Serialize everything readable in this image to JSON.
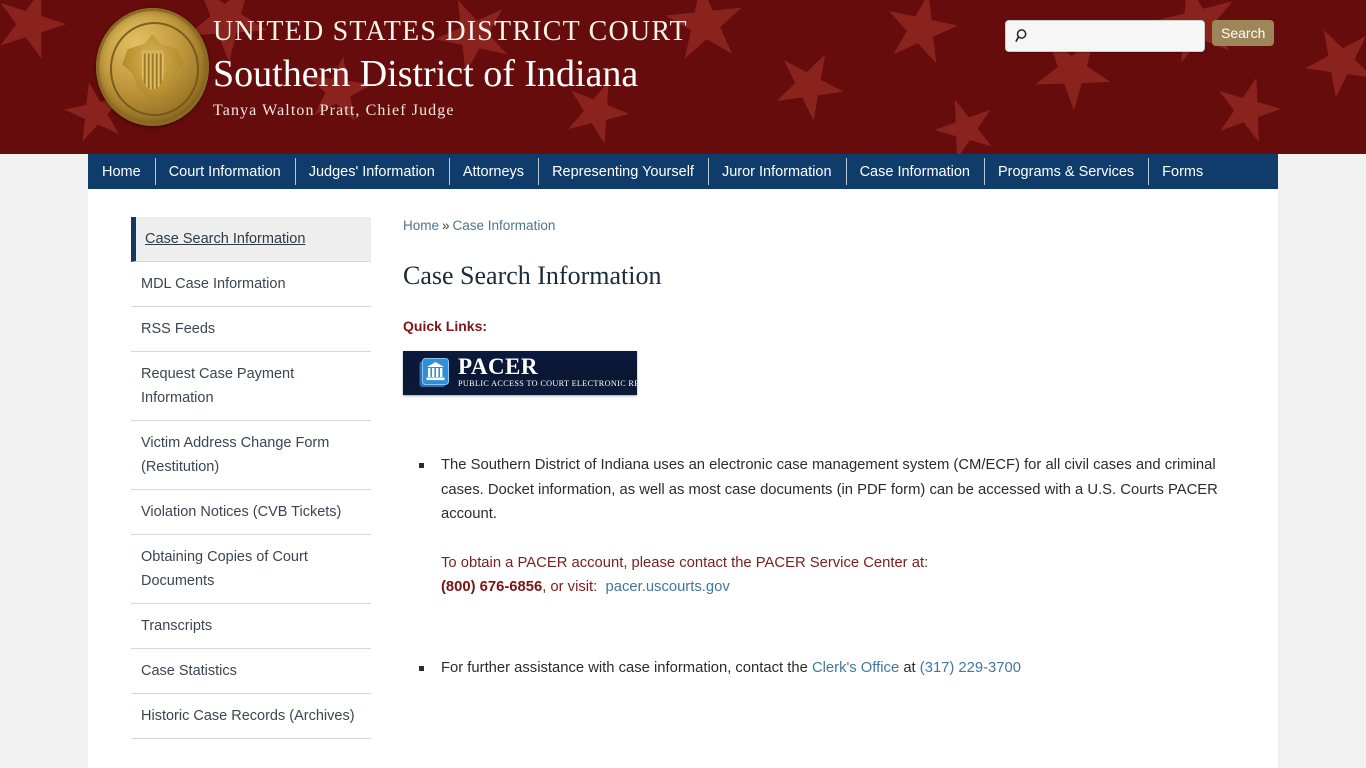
{
  "header": {
    "seal_alt": "united-states-district-court-seal",
    "line1": "UNITED STATES DISTRICT COURT",
    "line2": "Southern District of Indiana",
    "line3": "Tanya Walton Pratt, Chief Judge"
  },
  "search": {
    "value": "",
    "placeholder": "",
    "button_label": "Search",
    "icon": "search-icon"
  },
  "nav": {
    "items": [
      {
        "label": "Home"
      },
      {
        "label": "Court Information"
      },
      {
        "label": "Judges' Information"
      },
      {
        "label": "Attorneys"
      },
      {
        "label": "Representing Yourself"
      },
      {
        "label": "Juror Information"
      },
      {
        "label": "Case Information"
      },
      {
        "label": "Programs & Services"
      },
      {
        "label": "Forms"
      }
    ]
  },
  "sidebar": {
    "items": [
      {
        "label": "Case Search Information",
        "active": true
      },
      {
        "label": "MDL Case Information",
        "active": false
      },
      {
        "label": "RSS Feeds",
        "active": false
      },
      {
        "label": "Request Case Payment Information",
        "active": false
      },
      {
        "label": "Victim Address Change Form (Restitution)",
        "active": false
      },
      {
        "label": "Violation Notices (CVB Tickets)",
        "active": false
      },
      {
        "label": "Obtaining Copies of Court Documents",
        "active": false
      },
      {
        "label": "Transcripts",
        "active": false
      },
      {
        "label": "Case Statistics",
        "active": false
      },
      {
        "label": "Historic Case Records (Archives)",
        "active": false
      }
    ]
  },
  "breadcrumb": {
    "home": "Home",
    "separator": "»",
    "current": "Case Information"
  },
  "main": {
    "page_title": "Case Search Information",
    "quick_links_label": "Quick Links:",
    "pacer": {
      "word": "PACER",
      "subtitle": "PUBLIC ACCESS TO COURT ELECTRONIC RECORDS",
      "icon": "courthouse-icon"
    },
    "bullet1": {
      "text": "The Southern District of Indiana uses an electronic case management system (CM/ECF) for all civil cases and criminal cases. Docket information, as well as most case documents (in PDF form) can be accessed with a U.S. Courts PACER account.",
      "red_intro": "To obtain a PACER account, please contact the PACER Service Center at:",
      "phone": "(800) 676-6856",
      "visit_text": ", or visit:",
      "link_label": "pacer.uscourts.gov"
    },
    "bullet2": {
      "prefix": "For further assistance with case information, contact the",
      "clerk_link": "Clerk's Office",
      "middle": "at",
      "phone_link": "(317) 229-3700"
    }
  },
  "colors": {
    "header_maroon": "#660c0c",
    "star_red": "#8a221e",
    "nav_navy": "#0f3c6b",
    "search_button": "#9d8657",
    "link_blue": "#4078a0",
    "accent_red": "#7a2020",
    "sidebar_active_border": "#13395f"
  }
}
